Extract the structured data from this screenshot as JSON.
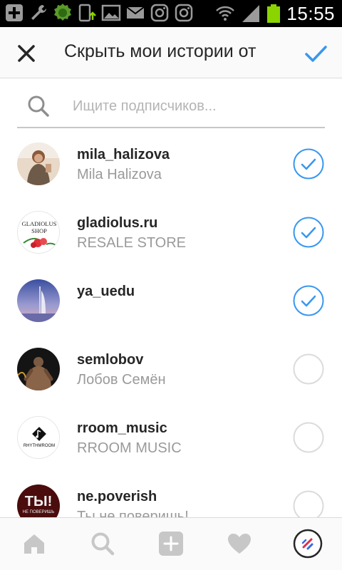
{
  "status_bar": {
    "time": "15:55",
    "left_icons": [
      "add-icon",
      "wrench-icon",
      "lion-app-icon",
      "phone-upload-icon",
      "image-icon",
      "mail-icon",
      "instagram-icon",
      "instagram-icon"
    ],
    "right_icons": [
      "wifi-icon",
      "signal-icon",
      "battery-icon"
    ],
    "battery_color": "#8bd400"
  },
  "header": {
    "title": "Скрыть мои истории от",
    "close_icon": "close-icon",
    "confirm_icon": "checkmark-icon",
    "accent_color": "#3897f0"
  },
  "search": {
    "placeholder": "Ищите подписчиков...",
    "value": ""
  },
  "followers": [
    {
      "username": "mila_halizova",
      "full_name": "Mila Halizova",
      "selected": true
    },
    {
      "username": "gladiolus.ru",
      "full_name": "RESALE STORE",
      "selected": true,
      "avatar_text": [
        "GLADIOLUS",
        "SHOP"
      ]
    },
    {
      "username": "ya_uedu",
      "full_name": "",
      "selected": true
    },
    {
      "username": "semlobov",
      "full_name": "Лобов Семён",
      "selected": false
    },
    {
      "username": "rroom_music",
      "full_name": "RROOM MUSIC",
      "selected": false,
      "avatar_text": [
        "RHYTHMROOM"
      ]
    },
    {
      "username": "ne.poverish",
      "full_name": "Ты не поверишь!",
      "selected": false,
      "avatar_text": [
        "ТЫ!",
        "НЕ ПОВЕРИШЬ"
      ]
    }
  ],
  "bottom_nav": {
    "items": [
      "home-icon",
      "search-icon",
      "add-post-icon",
      "heart-icon",
      "profile-icon"
    ]
  }
}
